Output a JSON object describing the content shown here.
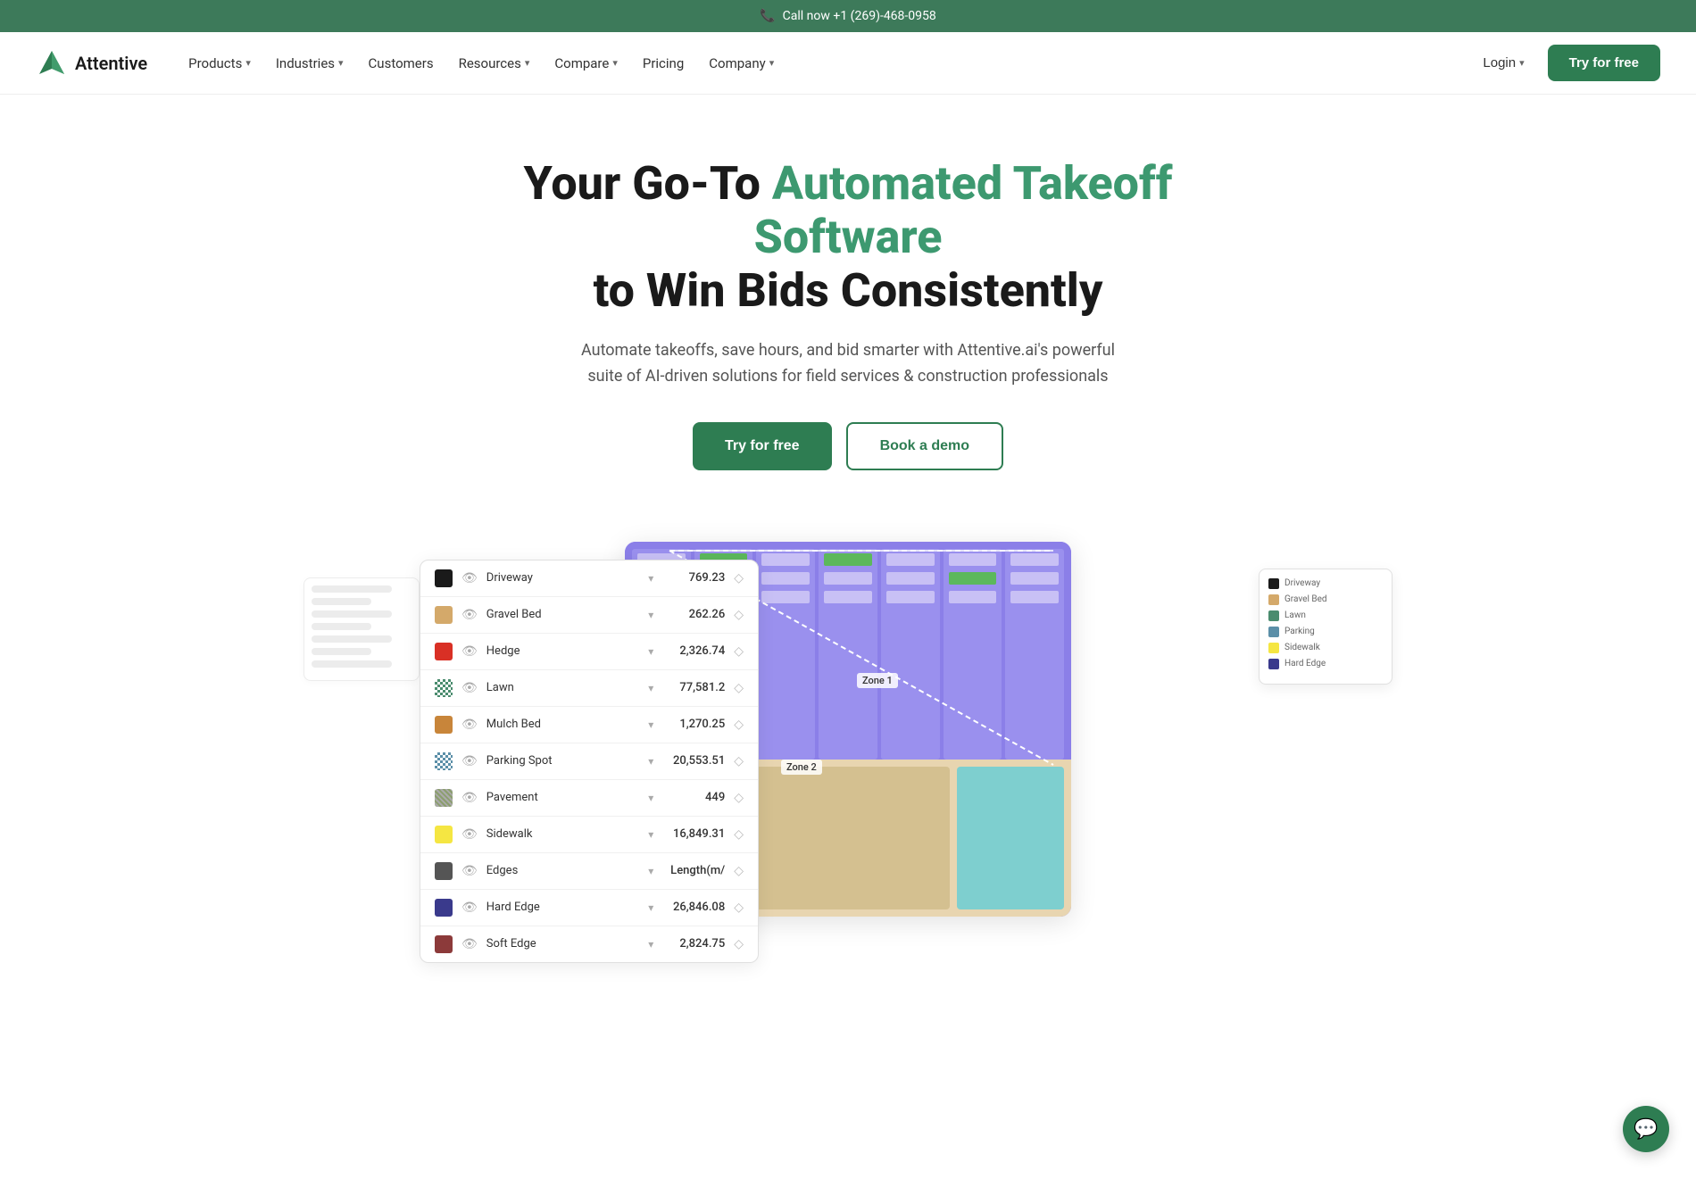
{
  "topbar": {
    "phone_icon": "📞",
    "text": "Call now +1 (269)-468-0958"
  },
  "header": {
    "logo_text": "Attentive",
    "nav": [
      {
        "label": "Products",
        "has_dropdown": true
      },
      {
        "label": "Industries",
        "has_dropdown": true
      },
      {
        "label": "Customers",
        "has_dropdown": false
      },
      {
        "label": "Resources",
        "has_dropdown": true
      },
      {
        "label": "Compare",
        "has_dropdown": true
      },
      {
        "label": "Pricing",
        "has_dropdown": false
      },
      {
        "label": "Company",
        "has_dropdown": true
      }
    ],
    "login_label": "Login",
    "try_free_label": "Try for free"
  },
  "hero": {
    "title_plain": "Your Go-To",
    "title_highlight": "Automated Takeoff Software",
    "title_end": "to Win Bids Consistently",
    "subtitle": "Automate takeoffs, save hours, and bid smarter with Attentive.ai's powerful suite of AI-driven solutions for field services & construction professionals",
    "btn_primary": "Try for free",
    "btn_secondary": "Book a demo"
  },
  "takeoff_list": {
    "rows": [
      {
        "name": "Driveway",
        "color": "#1a1a1a",
        "value": "769.23",
        "pattern": "solid"
      },
      {
        "name": "Gravel Bed",
        "color": "#d4a96a",
        "value": "262.26",
        "pattern": "solid"
      },
      {
        "name": "Hedge",
        "color": "#d93025",
        "value": "2,326.74",
        "pattern": "solid"
      },
      {
        "name": "Lawn",
        "color": "#4a8c6e",
        "value": "77,581.2",
        "pattern": "checker"
      },
      {
        "name": "Mulch Bed",
        "color": "#c8853a",
        "value": "1,270.25",
        "pattern": "solid"
      },
      {
        "name": "Parking Spot",
        "color": "#5b8fa8",
        "value": "20,553.51",
        "pattern": "checker"
      },
      {
        "name": "Pavement",
        "color": "#8b9e6e",
        "value": "449",
        "pattern": "hatch"
      },
      {
        "name": "Sidewalk",
        "color": "#f5e642",
        "value": "16,849.31",
        "pattern": "solid"
      },
      {
        "name": "Edges",
        "color": "#555",
        "value": "Length(m/",
        "pattern": "dots"
      },
      {
        "name": "Hard Edge",
        "color": "#3a3a8c",
        "value": "26,846.08",
        "pattern": "solid"
      },
      {
        "name": "Soft Edge",
        "color": "#8c3a3a",
        "value": "2,824.75",
        "pattern": "solid"
      }
    ]
  },
  "map": {
    "zone1_label": "Zone 1",
    "zone2_label": "Zone 2"
  },
  "mini_panel": {
    "items": [
      {
        "label": "Driveway",
        "color": "#1a1a1a"
      },
      {
        "label": "Gravel Bed",
        "color": "#d4a96a"
      },
      {
        "label": "Lawn",
        "color": "#4a8c6e"
      },
      {
        "label": "Parking",
        "color": "#5b8fa8"
      },
      {
        "label": "Sidewalk",
        "color": "#f5e642"
      },
      {
        "label": "Hard Edge",
        "color": "#3a3a8c"
      }
    ]
  },
  "chat": {
    "icon": "💬"
  }
}
